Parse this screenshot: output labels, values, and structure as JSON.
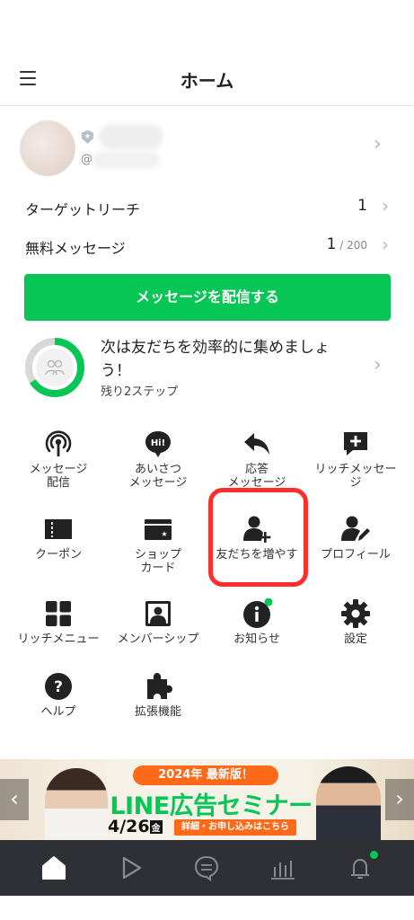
{
  "header": {
    "title": "ホーム"
  },
  "account": {
    "id_prefix": "@"
  },
  "stats": {
    "target_reach": {
      "label": "ターゲットリーチ",
      "value": "1"
    },
    "free_messages": {
      "label": "無料メッセージ",
      "value": "1",
      "limit": " / 200"
    }
  },
  "cta": {
    "label": "メッセージを配信する"
  },
  "progress": {
    "title": "次は友だちを効率的に集めましょう！",
    "subtitle": "残り2ステップ",
    "fraction": 0.66
  },
  "menu": [
    {
      "label": "メッセージ\n配信",
      "icon": "broadcast-icon"
    },
    {
      "label": "あいさつ\nメッセージ",
      "icon": "hi-bubble-icon"
    },
    {
      "label": "応答\nメッセージ",
      "icon": "reply-icon"
    },
    {
      "label": "リッチメッセー\nジ",
      "icon": "rich-message-icon"
    },
    {
      "label": "クーポン",
      "icon": "coupon-icon"
    },
    {
      "label": "ショップ\nカード",
      "icon": "shop-card-icon"
    },
    {
      "label": "友だちを増やす",
      "icon": "add-friend-icon"
    },
    {
      "label": "プロフィール",
      "icon": "profile-edit-icon"
    },
    {
      "label": "リッチメニュー",
      "icon": "rich-menu-icon"
    },
    {
      "label": "メンバーシップ",
      "icon": "membership-icon"
    },
    {
      "label": "お知らせ",
      "icon": "info-icon"
    },
    {
      "label": "設定",
      "icon": "gear-icon"
    },
    {
      "label": "ヘルプ",
      "icon": "help-icon"
    },
    {
      "label": "拡張機能",
      "icon": "puzzle-icon"
    }
  ],
  "banner": {
    "pill_year": "2024",
    "pill_text": "年 最新版！",
    "headline": "LINE広告セミナー",
    "date": "4/26",
    "weekday": "金",
    "detail": "詳細・お申し込みはこちら"
  },
  "nav": [
    "home-icon",
    "video-play-icon",
    "chat-icon",
    "analytics-icon",
    "notifications-icon"
  ],
  "colors": {
    "accent": "#06c755",
    "highlight": "#ff2d2d",
    "nav_bg": "#2e3035"
  }
}
